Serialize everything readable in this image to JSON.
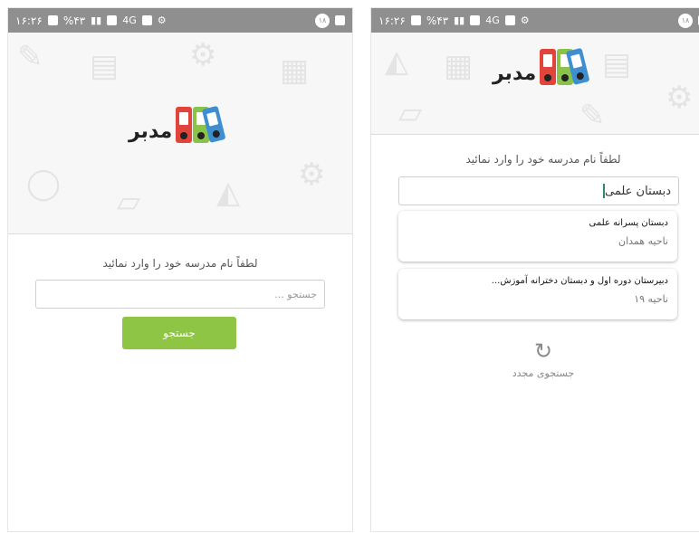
{
  "status_bar": {
    "time": "۱۶:۲۶",
    "battery": "%۴۳",
    "network": "4G",
    "badge": "۱۸"
  },
  "logo": {
    "text": "مدبر"
  },
  "left_screen": {
    "prompt": "لطفاً نام مدرسه خود را وارد نمائید",
    "search_placeholder": "جستجو ...",
    "search_button": "جستجو"
  },
  "right_screen": {
    "prompt": "لطفاً نام مدرسه خود را وارد نمائید",
    "search_value": "دبستان علمی",
    "results": [
      {
        "title": "دبستان پسرانه علمی",
        "subtitle": "ناحیه همدان"
      },
      {
        "title": "دبیرستان دوره اول و دبستان دخترانه آموزش...",
        "subtitle": "ناحیه ۱۹"
      }
    ],
    "retry_label": "جستجوی مجدد"
  },
  "colors": {
    "status_bar": "#8f8f8f",
    "button": "#8fc545",
    "binder_red": "#e1443a",
    "binder_green": "#8bc34a",
    "binder_blue": "#3f8fd0"
  }
}
